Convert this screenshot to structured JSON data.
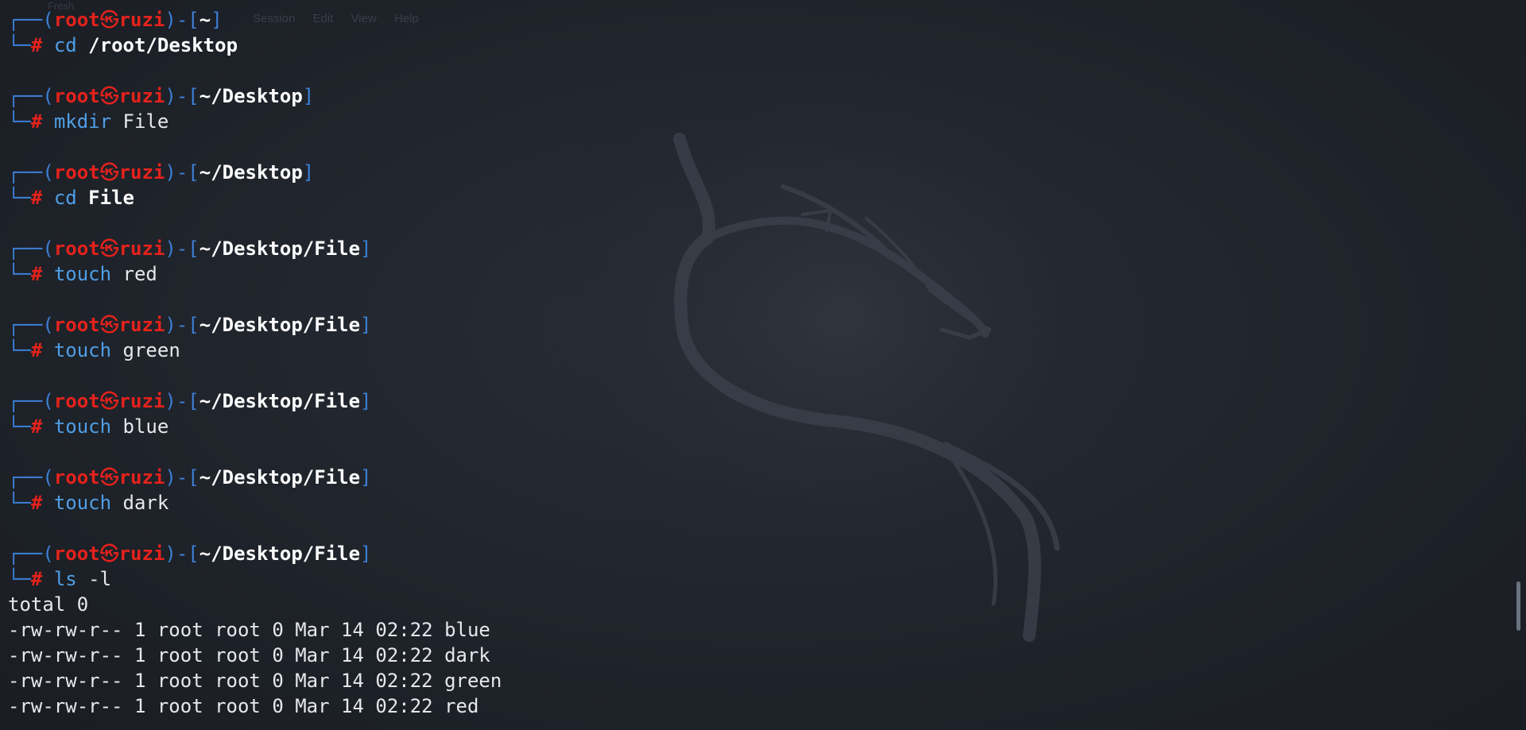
{
  "background_menu": {
    "title": "Fresh",
    "items": [
      "Session",
      "Edit",
      "View",
      "Help"
    ]
  },
  "prompt": {
    "user": "root",
    "host": "ruzi",
    "symbol": "㉿",
    "hash": "#"
  },
  "blocks": [
    {
      "path": "~",
      "command": "cd",
      "argument": "/root/Desktop",
      "arg_bold": true
    },
    {
      "path": "~/Desktop",
      "command": "mkdir",
      "argument": "File",
      "arg_bold": false
    },
    {
      "path": "~/Desktop",
      "command": "cd",
      "argument": "File",
      "arg_bold": true
    },
    {
      "path": "~/Desktop/File",
      "command": "touch",
      "argument": "red",
      "arg_bold": false
    },
    {
      "path": "~/Desktop/File",
      "command": "touch",
      "argument": "green",
      "arg_bold": false
    },
    {
      "path": "~/Desktop/File",
      "command": "touch",
      "argument": "blue",
      "arg_bold": false
    },
    {
      "path": "~/Desktop/File",
      "command": "touch",
      "argument": "dark",
      "arg_bold": false
    },
    {
      "path": "~/Desktop/File",
      "command": "ls",
      "argument": "-l",
      "arg_bold": false
    }
  ],
  "output": [
    "total 0",
    "-rw-rw-r-- 1 root root 0 Mar 14 02:22 blue",
    "-rw-rw-r-- 1 root root 0 Mar 14 02:22 dark",
    "-rw-rw-r-- 1 root root 0 Mar 14 02:22 green",
    "-rw-rw-r-- 1 root root 0 Mar 14 02:22 red"
  ],
  "colors": {
    "background": "#1f232b",
    "frame": "#3c7fd6",
    "user": "#e5221c",
    "command": "#4f9ee6",
    "text": "#e6e8ec"
  },
  "icons": {
    "background": "kali-dragon-logo",
    "scroll": "scrollbar-thumb"
  }
}
